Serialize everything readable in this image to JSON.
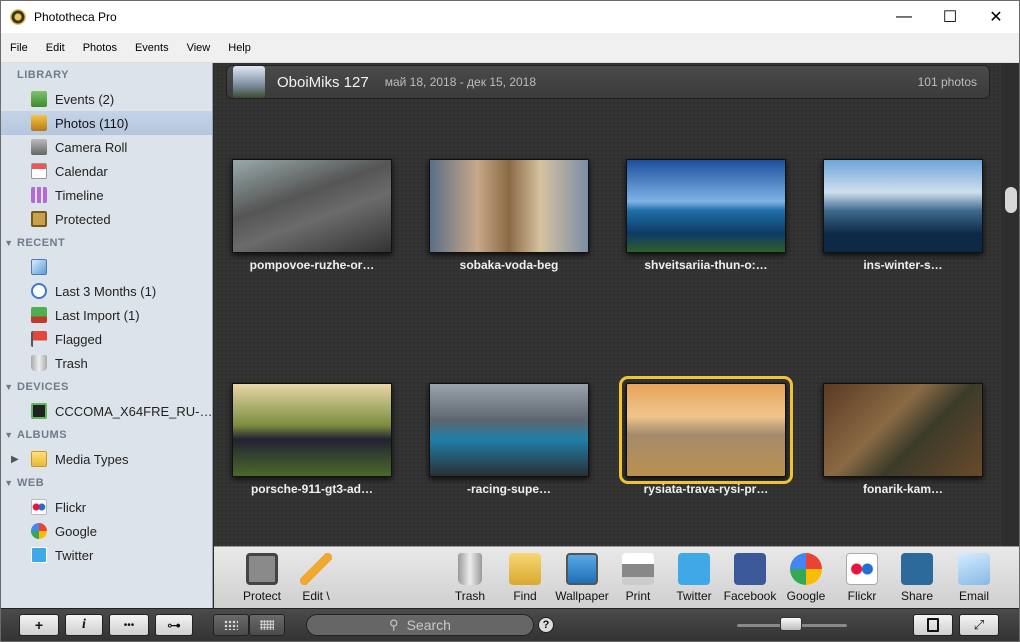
{
  "window": {
    "title": "Phototheca Pro",
    "minimize": "—",
    "maximize": "☐",
    "close": "✕"
  },
  "menu": [
    "File",
    "Edit",
    "Photos",
    "Events",
    "View",
    "Help"
  ],
  "sidebar": {
    "library": {
      "title": "LIBRARY",
      "items": [
        "Events (2)",
        "Photos (110)",
        "Camera Roll",
        "Calendar",
        "Timeline",
        "Protected"
      ]
    },
    "recent": {
      "title": "RECENT",
      "items": [
        "",
        "Last 3 Months (1)",
        "Last Import (1)",
        "Flagged",
        "Trash"
      ]
    },
    "devices": {
      "title": "DEVICES",
      "items": [
        "CCCOMA_X64FRE_RU-…"
      ]
    },
    "albums": {
      "title": "ALBUMS",
      "items": [
        "Media Types"
      ]
    },
    "web": {
      "title": "WEB",
      "items": [
        "Flickr",
        "Google",
        "Twitter"
      ]
    }
  },
  "header": {
    "name": "OboiMiks 127",
    "dates": "май 18, 2018 - дек 15, 2018",
    "count": "101 photos"
  },
  "photos": [
    {
      "caption": "pompovoe-ruzhe-or…"
    },
    {
      "caption": "sobaka-voda-beg"
    },
    {
      "caption": "shveitsariia-thun-o:…"
    },
    {
      "caption": "ins-winter-s…"
    },
    {
      "caption": "porsche-911-gt3-ad…"
    },
    {
      "caption": "-racing-supe…"
    },
    {
      "caption": "rysiata-trava-rysi-pr…"
    },
    {
      "caption": "fonarik-kam…"
    }
  ],
  "toolbar": [
    "Protect",
    "Edit \\",
    "Trash",
    "Find",
    "Wallpaper",
    "Print",
    "Twitter",
    "Facebook",
    "Google",
    "Flickr",
    "Share",
    "Email"
  ],
  "bottombar": {
    "add": "+",
    "info": "i",
    "more": "•••",
    "key": "⊶",
    "search_placeholder": "Search",
    "help": "?"
  }
}
